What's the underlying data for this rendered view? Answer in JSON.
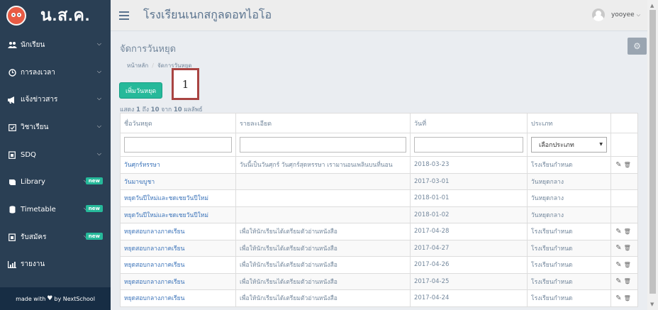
{
  "brand": {
    "name": "น.ส.ค."
  },
  "sidebar": {
    "items": [
      {
        "label": "นักเรียน",
        "icon": "users-icon"
      },
      {
        "label": "การลงเวลา",
        "icon": "clock-icon"
      },
      {
        "label": "แจ้งข่าวสาร",
        "icon": "bullhorn-icon"
      },
      {
        "label": "วิชาเรียน",
        "icon": "calendar-check-icon"
      },
      {
        "label": "SDQ",
        "icon": "clipboard-icon"
      },
      {
        "label": "Library",
        "icon": "book-icon",
        "badge": "new"
      },
      {
        "label": "Timetable",
        "icon": "database-icon",
        "badge": "new"
      },
      {
        "label": "รับสมัคร",
        "icon": "clipboard-icon",
        "badge": "new"
      },
      {
        "label": "รายงาน",
        "icon": "bar-chart-icon"
      }
    ],
    "footer": {
      "pre": "made with",
      "post": "by NextSchool"
    }
  },
  "topnav": {
    "school_name": "โรงเรียนเนกสกูลดอทไอโอ",
    "user": "yooyee"
  },
  "page": {
    "title": "จัดการวันหยุด",
    "breadcrumb": [
      "หน้าหลัก",
      "จัดการวันหยุด"
    ],
    "add_button": "เพิ่มวันหยุด",
    "callout": "1",
    "result_count": {
      "pre": "แสดง",
      "from": "1",
      "mid1": "ถึง",
      "to": "10",
      "mid2": "จาก",
      "total": "10",
      "post": "ผลลัพธ์"
    }
  },
  "table": {
    "headers": [
      "ชื่อวันหยุด",
      "รายละเอียด",
      "วันที่",
      "ประเภท",
      ""
    ],
    "type_filter": "เลือกประเภท",
    "rows": [
      {
        "name": "วันศุกร์หรรษา",
        "detail": "วันนี้เป็นวันศุกร์ วันศุกร์สุดหรรษา เรามานอนเพลินบนที่นอน",
        "date": "2018-03-23",
        "type": "โรงเรียนกำหนด",
        "actions": true
      },
      {
        "name": "วันมาฆบูชา",
        "detail": "",
        "date": "2017-03-01",
        "type": "วันหยุดกลาง",
        "actions": false
      },
      {
        "name": "หยุดวันปีใหม่และชดเชยวันปีใหม่",
        "detail": "",
        "date": "2018-01-01",
        "type": "วันหยุดกลาง",
        "actions": false
      },
      {
        "name": "หยุดวันปีใหม่และชดเชยวันปีใหม่",
        "detail": "",
        "date": "2018-01-02",
        "type": "วันหยุดกลาง",
        "actions": false
      },
      {
        "name": "หยุดสอบกลางภาคเรียน",
        "detail": "เพื่อให้นักเรียนได้เตรียมตัวอ่านหนังสือ",
        "date": "2017-04-28",
        "type": "โรงเรียนกำหนด",
        "actions": true
      },
      {
        "name": "หยุดสอบกลางภาคเรียน",
        "detail": "เพื่อให้นักเรียนได้เตรียมตัวอ่านหนังสือ",
        "date": "2017-04-27",
        "type": "โรงเรียนกำหนด",
        "actions": true
      },
      {
        "name": "หยุดสอบกลางภาคเรียน",
        "detail": "เพื่อให้นักเรียนได้เตรียมตัวอ่านหนังสือ",
        "date": "2017-04-26",
        "type": "โรงเรียนกำหนด",
        "actions": true
      },
      {
        "name": "หยุดสอบกลางภาคเรียน",
        "detail": "เพื่อให้นักเรียนได้เตรียมตัวอ่านหนังสือ",
        "date": "2017-04-25",
        "type": "โรงเรียนกำหนด",
        "actions": true
      },
      {
        "name": "หยุดสอบกลางภาคเรียน",
        "detail": "เพื่อให้นักเรียนได้เตรียมตัวอ่านหนังสือ",
        "date": "2017-04-24",
        "type": "โรงเรียนกำหนด",
        "actions": true
      }
    ]
  },
  "colors": {
    "sidebar": "#2a3f54",
    "accent": "#26b99a",
    "link": "#3b73b9",
    "callout_border": "#a94442"
  }
}
